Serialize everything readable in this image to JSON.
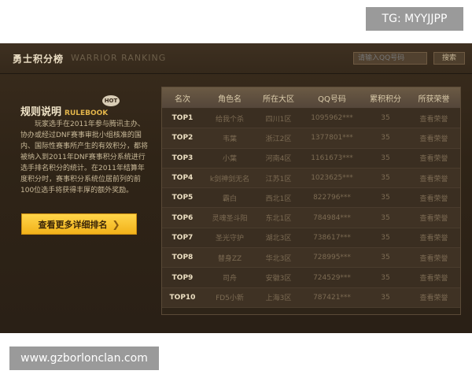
{
  "overlay": {
    "tg_label": "TG: MYYJJPP",
    "site_url": "www.gzborlonclan.com"
  },
  "header": {
    "title": "勇士积分榜",
    "subtitle": "WARRIOR RANKING",
    "search_placeholder": "请输入QQ号码",
    "search_button": "搜索"
  },
  "rules": {
    "heading": "规则说明",
    "heading_en": "RULEBOOK",
    "hot": "HOT",
    "text": "玩家选手在2011年参与腾讯主办、协办或经过DNF赛事审批小组核准的国内、国际性赛事所产生的有效积分，都将被纳入到2011年DNF赛事积分系统进行选手排名积分的统计。在2011年结算年度积分时，赛事积分系统位居前列的前100位选手将获得丰厚的额外奖励。",
    "more_button": "查看更多详细排名",
    "more_arrow": "❯"
  },
  "table": {
    "columns": [
      "名次",
      "角色名",
      "所在大区",
      "QQ号码",
      "累积积分",
      "所获荣誉"
    ],
    "rows": [
      {
        "rank": "TOP1",
        "name": "给我个杀",
        "region": "四川1区",
        "qq": "1095962***",
        "score": "35",
        "honor": "查看荣誉"
      },
      {
        "rank": "TOP2",
        "name": "韦葉",
        "region": "浙江2区",
        "qq": "1377801***",
        "score": "35",
        "honor": "查看荣誉"
      },
      {
        "rank": "TOP3",
        "name": "小葉",
        "region": "河南4区",
        "qq": "1161673***",
        "score": "35",
        "honor": "查看荣誉"
      },
      {
        "rank": "TOP4",
        "name": "k剑神剑无名",
        "region": "江苏1区",
        "qq": "1023625***",
        "score": "35",
        "honor": "查看荣誉"
      },
      {
        "rank": "TOP5",
        "name": "霸白",
        "region": "西北1区",
        "qq": "822796***",
        "score": "35",
        "honor": "查看荣誉"
      },
      {
        "rank": "TOP6",
        "name": "灵魂圣斗阳",
        "region": "东北1区",
        "qq": "784984***",
        "score": "35",
        "honor": "查看荣誉"
      },
      {
        "rank": "TOP7",
        "name": "圣光守护",
        "region": "湖北3区",
        "qq": "738617***",
        "score": "35",
        "honor": "查看荣誉"
      },
      {
        "rank": "TOP8",
        "name": "替身ZZ",
        "region": "华北3区",
        "qq": "728995***",
        "score": "35",
        "honor": "查看荣誉"
      },
      {
        "rank": "TOP9",
        "name": "司舟",
        "region": "安徽3区",
        "qq": "724529***",
        "score": "35",
        "honor": "查看荣誉"
      },
      {
        "rank": "TOP10",
        "name": "FD5小新",
        "region": "上海3区",
        "qq": "787421***",
        "score": "35",
        "honor": "查看荣誉"
      }
    ]
  }
}
